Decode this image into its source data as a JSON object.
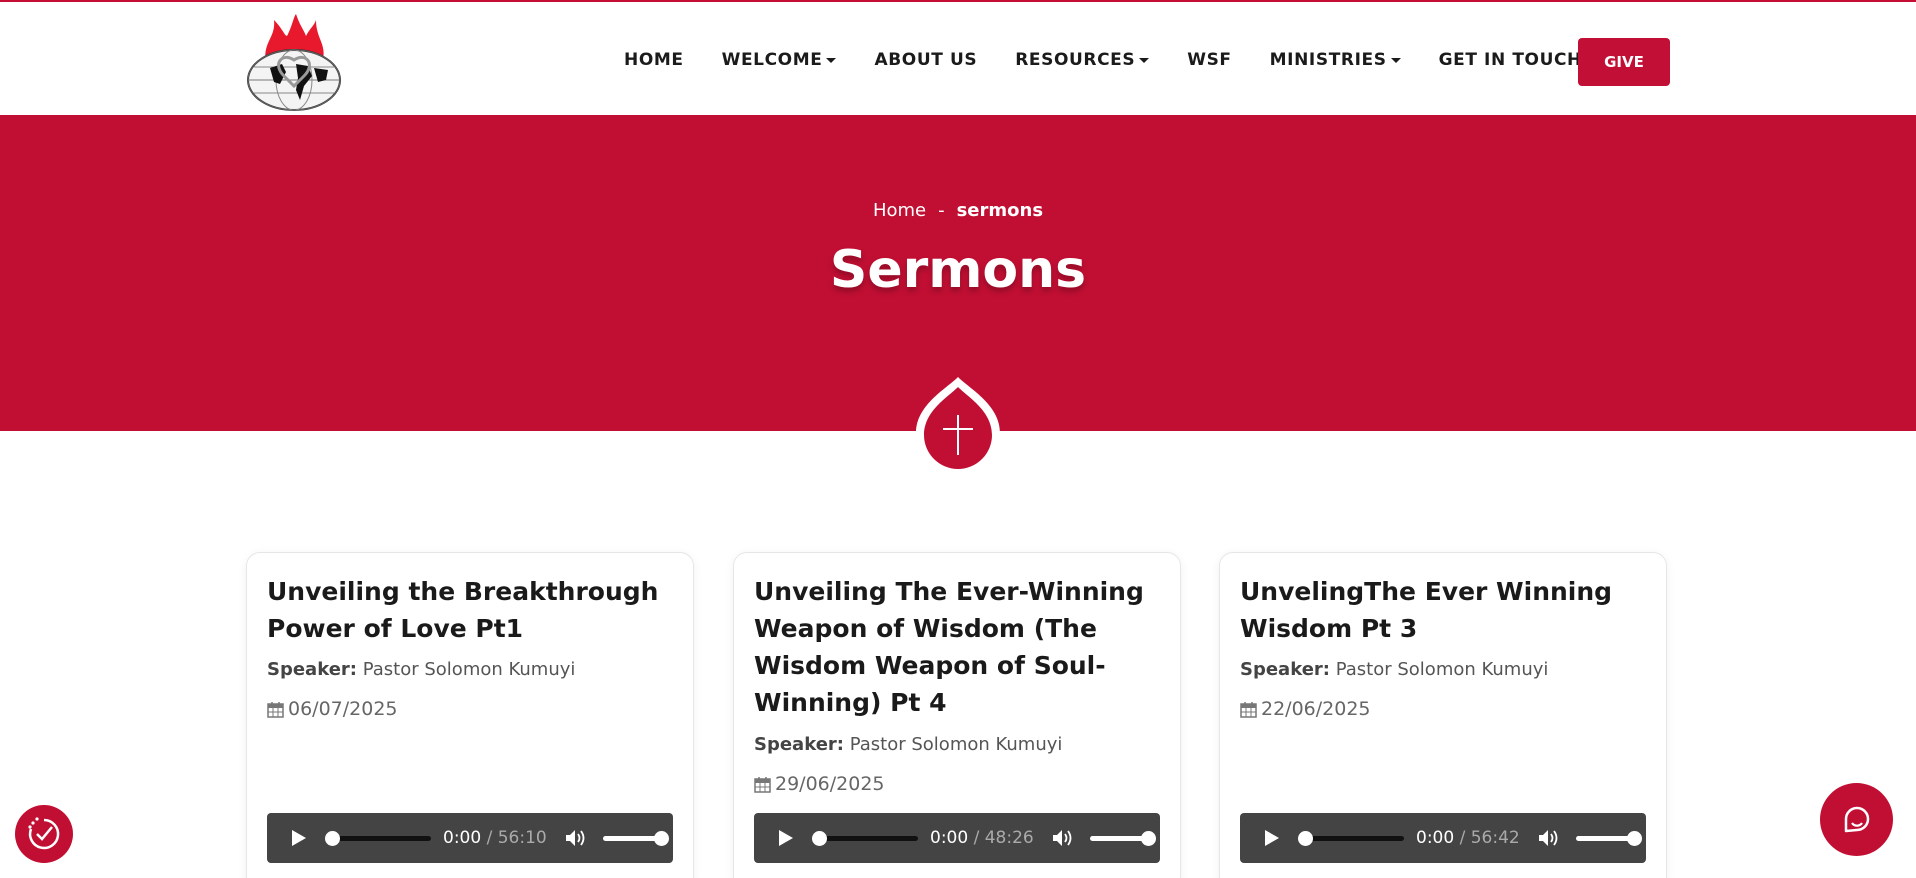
{
  "colors": {
    "brand": "#c10f33",
    "player": "#444444"
  },
  "nav": {
    "items": [
      {
        "label": "HOME",
        "dropdown": false
      },
      {
        "label": "WELCOME",
        "dropdown": true
      },
      {
        "label": "ABOUT US",
        "dropdown": false
      },
      {
        "label": "RESOURCES",
        "dropdown": true
      },
      {
        "label": "WSF",
        "dropdown": false
      },
      {
        "label": "MINISTRIES",
        "dropdown": true
      },
      {
        "label": "GET IN TOUCH",
        "dropdown": false
      }
    ],
    "give_label": "GIVE"
  },
  "hero": {
    "breadcrumb_home": "Home",
    "breadcrumb_sep": "-",
    "breadcrumb_current": "sermons",
    "title": "Sermons"
  },
  "sermons": [
    {
      "title": "Unveiling the Breakthrough Power of Love Pt1",
      "speaker_label": "Speaker:",
      "speaker": "Pastor Solomon Kumuyi",
      "date": "06/07/2025",
      "current_time": "0:00",
      "duration": "56:10"
    },
    {
      "title": "Unveiling The Ever-Winning Weapon of Wisdom (The Wisdom Weapon of Soul-Winning) Pt 4",
      "speaker_label": "Speaker:",
      "speaker": "Pastor Solomon Kumuyi",
      "date": "29/06/2025",
      "current_time": "0:00",
      "duration": "48:26"
    },
    {
      "title": "UnvelingThe Ever Winning Wisdom Pt 3",
      "speaker_label": "Speaker:",
      "speaker": "Pastor Solomon Kumuyi",
      "date": "22/06/2025",
      "current_time": "0:00",
      "duration": "56:42"
    }
  ]
}
